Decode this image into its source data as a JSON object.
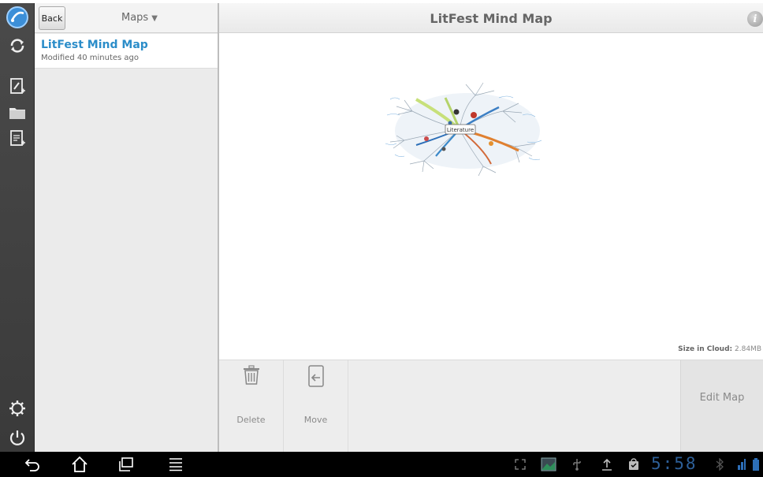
{
  "list_panel": {
    "back_label": "Back",
    "dropdown_label": "Maps",
    "items": [
      {
        "title": "LitFest Mind Map",
        "subtitle": "Modified 40 minutes ago"
      }
    ]
  },
  "detail": {
    "title": "LitFest Mind Map",
    "preview_center_label": "Literature",
    "size_label": "Size in Cloud:",
    "size_value": "2.84MB"
  },
  "actions": {
    "delete_label": "Delete",
    "move_label": "Move",
    "edit_label": "Edit Map"
  },
  "system_bar": {
    "clock": "5:58"
  },
  "colors": {
    "accent": "#2b8dc9",
    "rail": "#404040",
    "clock": "#2d5f98"
  }
}
